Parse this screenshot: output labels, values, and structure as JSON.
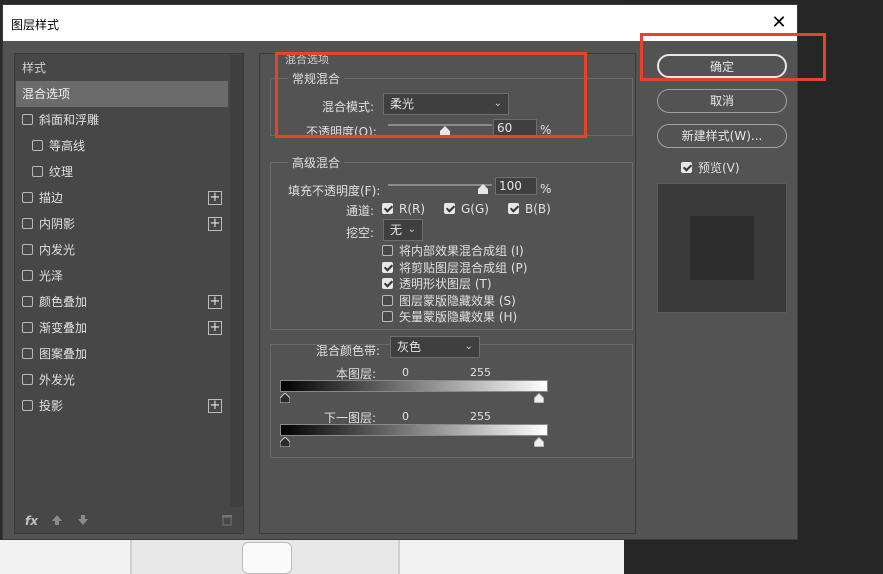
{
  "dialog": {
    "title": "图层样式",
    "close_glyph": "✕"
  },
  "left_panel": {
    "header": "样式",
    "items": [
      {
        "label": "混合选项",
        "selected": true,
        "checkbox": false,
        "plus": false,
        "indent": false
      },
      {
        "label": "斜面和浮雕",
        "checkbox": true,
        "checked": false,
        "plus": false,
        "indent": false
      },
      {
        "label": "等高线",
        "checkbox": true,
        "checked": false,
        "plus": false,
        "indent": true
      },
      {
        "label": "纹理",
        "checkbox": true,
        "checked": false,
        "plus": false,
        "indent": true
      },
      {
        "label": "描边",
        "checkbox": true,
        "checked": false,
        "plus": true,
        "indent": false
      },
      {
        "label": "内阴影",
        "checkbox": true,
        "checked": false,
        "plus": true,
        "indent": false
      },
      {
        "label": "内发光",
        "checkbox": true,
        "checked": false,
        "plus": false,
        "indent": false
      },
      {
        "label": "光泽",
        "checkbox": true,
        "checked": false,
        "plus": false,
        "indent": false
      },
      {
        "label": "颜色叠加",
        "checkbox": true,
        "checked": false,
        "plus": true,
        "indent": false
      },
      {
        "label": "渐变叠加",
        "checkbox": true,
        "checked": false,
        "plus": true,
        "indent": false
      },
      {
        "label": "图案叠加",
        "checkbox": true,
        "checked": false,
        "plus": false,
        "indent": false
      },
      {
        "label": "外发光",
        "checkbox": true,
        "checked": false,
        "plus": false,
        "indent": false
      },
      {
        "label": "投影",
        "checkbox": true,
        "checked": false,
        "plus": true,
        "indent": false
      }
    ],
    "bottom_icons": [
      "fx-icon",
      "arrow-up-icon",
      "arrow-down-icon",
      "trash-icon"
    ],
    "fx_label": "fx"
  },
  "blending": {
    "section_title": "混合选项",
    "general": {
      "title": "常规混合",
      "blend_mode_label": "混合模式:",
      "blend_mode_value": "柔光",
      "opacity_label": "不透明度(O):",
      "opacity_value": "60",
      "opacity_unit": "%"
    },
    "advanced": {
      "title": "高级混合",
      "fill_opacity_label": "填充不透明度(F):",
      "fill_opacity_value": "100",
      "fill_unit": "%",
      "channels_label": "通道:",
      "channel_r": "R(R)",
      "channel_g": "G(G)",
      "channel_b": "B(B)",
      "knockout_label": "挖空:",
      "knockout_value": "无",
      "options": [
        {
          "label": "将内部效果混合成组 (I)",
          "checked": false
        },
        {
          "label": "将剪贴图层混合成组 (P)",
          "checked": true
        },
        {
          "label": "透明形状图层 (T)",
          "checked": true
        },
        {
          "label": "图层蒙版隐藏效果 (S)",
          "checked": false
        },
        {
          "label": "矢量蒙版隐藏效果 (H)",
          "checked": false
        }
      ]
    },
    "blend_if": {
      "label": "混合颜色带:",
      "value": "灰色",
      "this_layer_label": "本图层:",
      "this_layer_min": "0",
      "this_layer_max": "255",
      "underlying_label": "下一图层:",
      "underlying_min": "0",
      "underlying_max": "255"
    }
  },
  "right_panel": {
    "ok": "确定",
    "cancel": "取消",
    "new_style": "新建样式(W)...",
    "preview_label": "预览(V)",
    "preview_checked": true
  },
  "colors": {
    "dialog_bg": "#535353",
    "highlight": "#e5432a"
  }
}
